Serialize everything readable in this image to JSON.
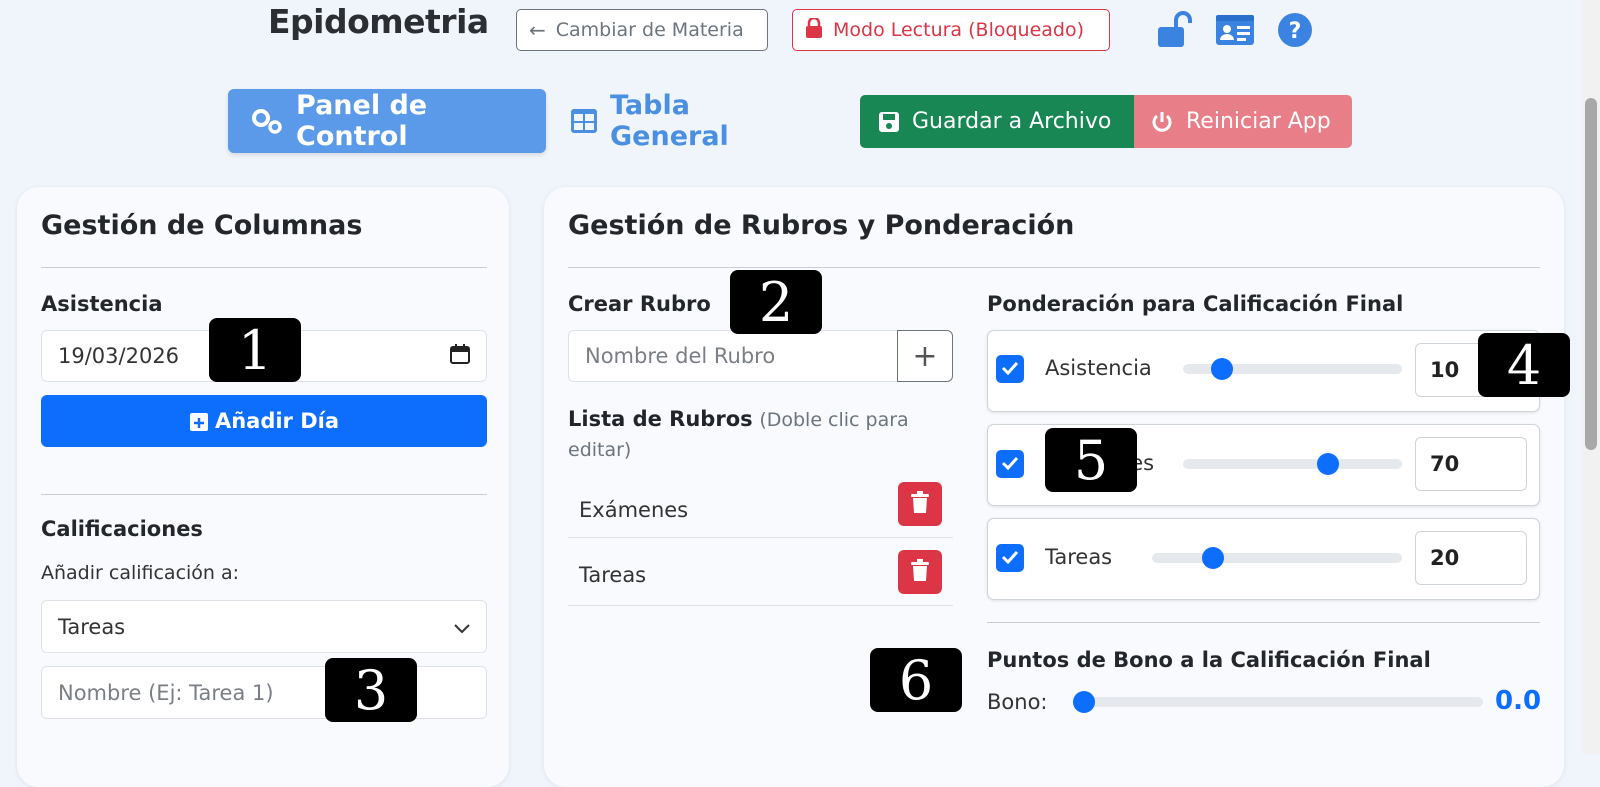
{
  "header": {
    "app_title": "Epidometria",
    "change_subject_label": "Cambiar de Materia",
    "read_mode_label": "Modo Lectura (Bloqueado)"
  },
  "nav": {
    "panel_label": "Panel de Control",
    "table_label": "Tabla General",
    "save_label": "Guardar a Archivo",
    "reset_label": "Reiniciar App"
  },
  "left": {
    "title": "Gestión de Columnas",
    "attendance_label": "Asistencia",
    "date_value": "19/03/2026",
    "add_day_label": "Añadir Día",
    "grades_label": "Calificaciones",
    "add_grade_to_label": "Añadir calificación a:",
    "select_value": "Tareas",
    "name_placeholder": "Nombre (Ej: Tarea 1)"
  },
  "right": {
    "title": "Gestión de Rubros y Ponderación",
    "create_label": "Crear Rubro",
    "rubro_placeholder": "Nombre del Rubro",
    "list_label": "Lista de Rubros",
    "list_hint": "(Doble clic para editar)",
    "rubros": [
      "Exámenes",
      "Tareas"
    ],
    "weighting_label": "Ponderación para Calificación Final",
    "weights": [
      {
        "name": "Asistencia",
        "value": "10",
        "fraction": 0.14
      },
      {
        "name": "Exámenes",
        "value": "70",
        "fraction": 0.68
      },
      {
        "name": "Tareas",
        "value": "20",
        "fraction": 0.22
      }
    ],
    "bonus_title": "Puntos de Bono a la Calificación Final",
    "bonus_label": "Bono:",
    "bonus_value": "0.0",
    "bonus_fraction": 0.0
  },
  "markers": [
    "1",
    "2",
    "3",
    "4",
    "5",
    "6"
  ],
  "colors": {
    "primary": "#0d6efd",
    "success": "#198754",
    "danger": "#dc3545",
    "nav_active": "#5b9ae8"
  }
}
